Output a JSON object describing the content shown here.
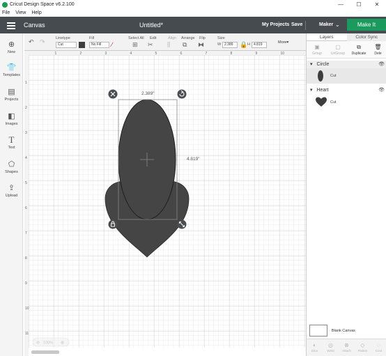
{
  "window": {
    "title": "Cricut Design Space  v6.2.100",
    "minimize": "—",
    "maximize": "☐",
    "close": "✕"
  },
  "menu": [
    "File",
    "View",
    "Help"
  ],
  "header": {
    "section": "Canvas",
    "doc_title": "Untitled*",
    "my_projects": "My Projects",
    "save": "Save",
    "machine": "Maker",
    "make_it": "Make It"
  },
  "toolbar": {
    "linetype_label": "Linetype",
    "linetype_value": "Cut",
    "fill_label": "Fill",
    "fill_value": "No Fill",
    "select_all_label": "Select All",
    "edit_label": "Edit",
    "align_label": "Align",
    "arrange_label": "Arrange",
    "flip_label": "Flip",
    "size_label": "Size",
    "w_label": "W",
    "w_value": "2.389",
    "h_label": "H",
    "h_value": "4.819",
    "more_label": "More▾",
    "swatch_color": "#3b3d3f"
  },
  "sidebar": [
    {
      "label": "New",
      "icon": "plus-circle-icon",
      "glyph": "⊕"
    },
    {
      "label": "Templates",
      "icon": "shirt-icon",
      "glyph": "👕"
    },
    {
      "label": "Projects",
      "icon": "projects-icon",
      "glyph": "▤"
    },
    {
      "label": "Images",
      "icon": "images-icon",
      "glyph": "◧"
    },
    {
      "label": "Text",
      "icon": "text-icon",
      "glyph": "T"
    },
    {
      "label": "Shapes",
      "icon": "shapes-icon",
      "glyph": "⬠"
    },
    {
      "label": "Upload",
      "icon": "upload-icon",
      "glyph": "⇪"
    }
  ],
  "canvas": {
    "ruler_top": [
      "1",
      "2",
      "3",
      "4",
      "5",
      "6",
      "7",
      "8",
      "9",
      "10"
    ],
    "ruler_left": [
      "1",
      "2",
      "3",
      "4",
      "5",
      "6",
      "7",
      "8",
      "9",
      "10",
      "11"
    ],
    "width_readout": "2.389\"",
    "height_readout": "4.819\"",
    "zoom": "100%",
    "shape_color": "#454545"
  },
  "panel": {
    "tabs": [
      "Layers",
      "Color Sync"
    ],
    "actions": [
      "Group",
      "UnGroup",
      "Duplicate",
      "Dele"
    ],
    "layers": [
      {
        "name": "Circle",
        "op": "Cut",
        "shape": "ellipse"
      },
      {
        "name": "Heart",
        "op": "Cut",
        "shape": "heart"
      }
    ],
    "blank_canvas": "Blank Canvas",
    "bottom_actions": [
      "Slice",
      "Weld",
      "Attach",
      "Flatten",
      "Cont"
    ]
  },
  "colors": {
    "header": "#464b4f",
    "accent": "#1a9a5c"
  }
}
